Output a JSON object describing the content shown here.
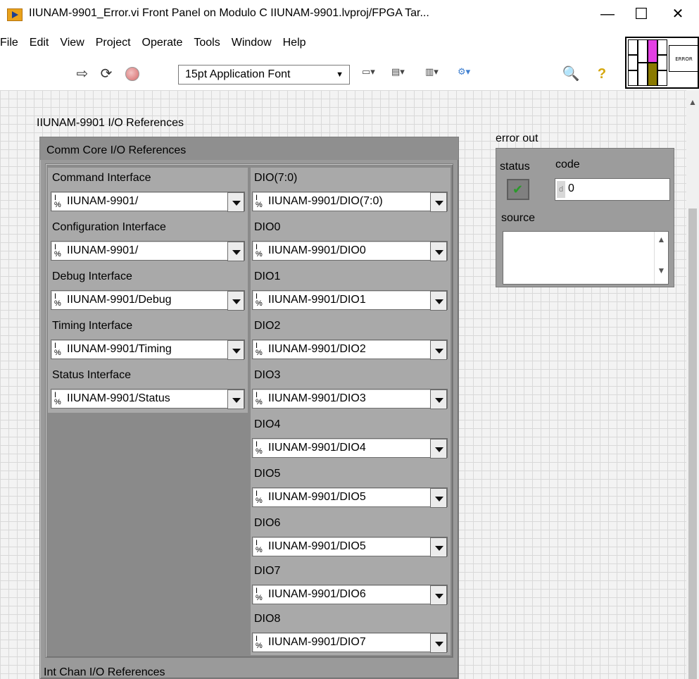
{
  "window": {
    "title": "IIUNAM-9901_Error.vi Front Panel on Modulo C IIUNAM-9901.lvproj/FPGA Tar...",
    "minimize": "—",
    "maximize": "☐",
    "close": "✕"
  },
  "menu": [
    "File",
    "Edit",
    "View",
    "Project",
    "Operate",
    "Tools",
    "Window",
    "Help"
  ],
  "toolbar": {
    "font_label": "15pt Application Font",
    "connector_label": "ERROR"
  },
  "panel": {
    "main_label": "IIUNAM-9901 I/O References",
    "comm_cluster_label": "Comm Core I/O References",
    "next_cluster_label": "Int Chan I/O References",
    "left_controls": [
      {
        "label": "Command Interface",
        "value": "IIUNAM-9901/"
      },
      {
        "label": "Configuration Interface",
        "value": "IIUNAM-9901/"
      },
      {
        "label": "Debug Interface",
        "value": "IIUNAM-9901/Debug"
      },
      {
        "label": "Timing Interface",
        "value": "IIUNAM-9901/Timing"
      },
      {
        "label": "Status Interface",
        "value": "IIUNAM-9901/Status"
      }
    ],
    "right_controls": [
      {
        "label": "DIO(7:0)",
        "value": "IIUNAM-9901/DIO(7:0)"
      },
      {
        "label": "DIO0",
        "value": "IIUNAM-9901/DIO0"
      },
      {
        "label": "DIO1",
        "value": "IIUNAM-9901/DIO1"
      },
      {
        "label": "DIO2",
        "value": "IIUNAM-9901/DIO2"
      },
      {
        "label": "DIO3",
        "value": "IIUNAM-9901/DIO3"
      },
      {
        "label": "DIO4",
        "value": "IIUNAM-9901/DIO4"
      },
      {
        "label": "DIO5",
        "value": "IIUNAM-9901/DIO5"
      },
      {
        "label": "DIO6",
        "value": "IIUNAM-9901/DIO5"
      },
      {
        "label": "DIO7",
        "value": "IIUNAM-9901/DIO6"
      },
      {
        "label": "DIO8",
        "value": "IIUNAM-9901/DIO7"
      }
    ]
  },
  "error_out": {
    "label": "error out",
    "status_label": "status",
    "code_label": "code",
    "code_radix": "d",
    "code_value": "0",
    "source_label": "source",
    "source_value": ""
  },
  "io_prefix": {
    "top": "I",
    "bottom": "%"
  }
}
